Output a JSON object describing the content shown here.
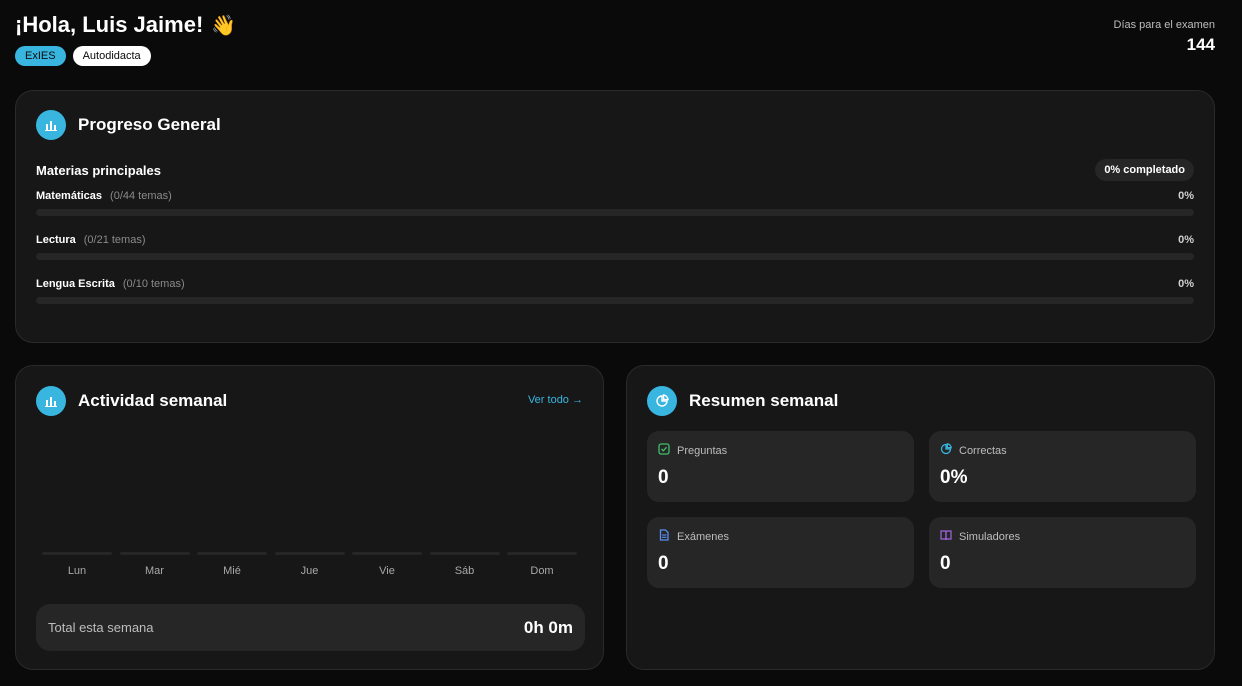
{
  "header": {
    "greeting": "¡Hola, Luis Jaime!",
    "wave_emoji": "👋",
    "tags": [
      "ExIES",
      "Autodidacta"
    ],
    "exam_label": "Días para el examen",
    "exam_days": "144"
  },
  "progress": {
    "title": "Progreso General",
    "subtitle": "Materias principales",
    "completed_label": "0% completado",
    "subjects": [
      {
        "name": "Matemáticas",
        "count": "(0/44 temas)",
        "percent": "0%",
        "fraction": 0
      },
      {
        "name": "Lectura",
        "count": "(0/21 temas)",
        "percent": "0%",
        "fraction": 0
      },
      {
        "name": "Lengua Escrita",
        "count": "(0/10 temas)",
        "percent": "0%",
        "fraction": 0
      }
    ]
  },
  "activity": {
    "title": "Actividad semanal",
    "view_all": "Ver todo →",
    "days": [
      "Lun",
      "Mar",
      "Mié",
      "Jue",
      "Vie",
      "Sáb",
      "Dom"
    ],
    "total_label": "Total esta semana",
    "total_value": "0h 0m"
  },
  "summary": {
    "title": "Resumen semanal",
    "stats": [
      {
        "label": "Preguntas",
        "value": "0",
        "icon": "check-square-icon",
        "color": "#3fbf6a"
      },
      {
        "label": "Correctas",
        "value": "0%",
        "icon": "pie-chart-icon",
        "color": "#38b6e0"
      },
      {
        "label": "Exámenes",
        "value": "0",
        "icon": "document-icon",
        "color": "#5b8ef0"
      },
      {
        "label": "Simuladores",
        "value": "0",
        "icon": "book-icon",
        "color": "#a066e0"
      }
    ]
  },
  "colors": {
    "accent": "#38b6e0",
    "background": "#0a0a0a",
    "card": "#171717"
  }
}
